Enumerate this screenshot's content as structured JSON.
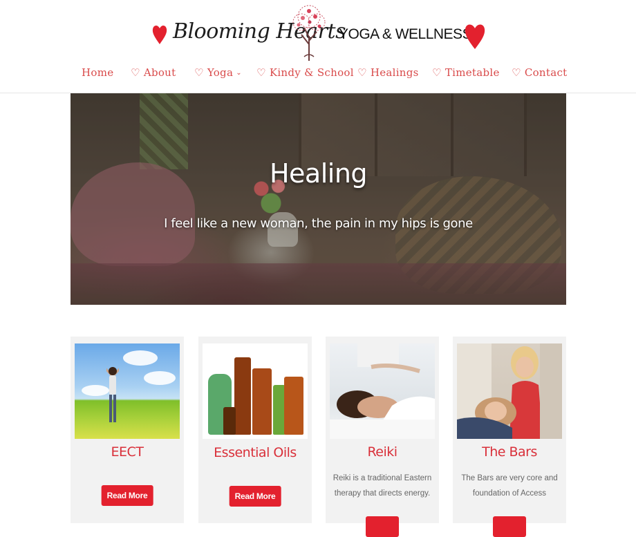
{
  "brand": {
    "script_name": "Blooming Hearts",
    "tagline": "YOGA & WELLNESS",
    "heart_color": "#e3212e"
  },
  "nav": {
    "items": [
      {
        "label": "Home"
      },
      {
        "label": "♡ About"
      },
      {
        "label": "♡ Yoga",
        "has_dropdown": true
      },
      {
        "label": "♡ Kindy & School"
      },
      {
        "label": "♡ Healings"
      },
      {
        "label": "♡ Timetable"
      },
      {
        "label": "♡ Contact"
      }
    ],
    "dropdown_icon": "chevron-down-icon",
    "link_color": "#d94a4a"
  },
  "hero": {
    "title": "Healing",
    "subtitle": "I feel like a new woman, the pain in my hips is gone"
  },
  "cards": [
    {
      "title": "EECT",
      "text": "",
      "button": "Read More"
    },
    {
      "title": "Essential Oils",
      "text": "",
      "button": "Read More"
    },
    {
      "title": "Reiki",
      "text": "Reiki is a traditional Eastern therapy that directs energy.",
      "button": ""
    },
    {
      "title": "The Bars",
      "text": "The Bars are very core and foundation of Access",
      "button": ""
    }
  ],
  "colors": {
    "accent": "#e3212e",
    "card_title": "#d9303a",
    "card_bg": "#f2f2f2"
  }
}
